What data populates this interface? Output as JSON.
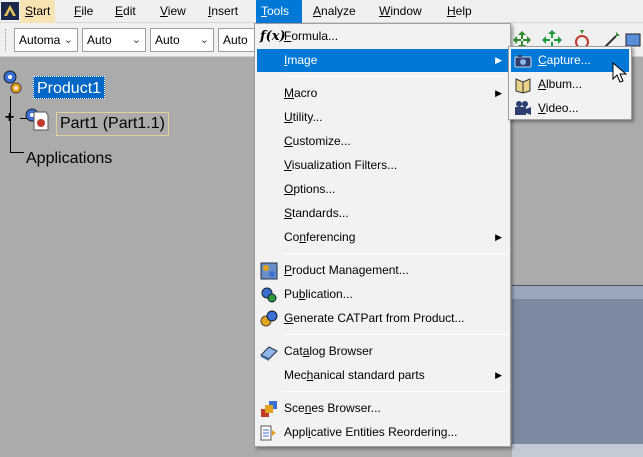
{
  "menubar": {
    "items": [
      {
        "label": "Start",
        "mnemonic": "S",
        "rest": "tart"
      },
      {
        "label": "File",
        "mnemonic": "F",
        "rest": "ile"
      },
      {
        "label": "Edit",
        "mnemonic": "E",
        "rest": "dit"
      },
      {
        "label": "View",
        "mnemonic": "V",
        "rest": "iew"
      },
      {
        "label": "Insert",
        "mnemonic": "I",
        "rest": "nsert"
      },
      {
        "label": "Tools",
        "mnemonic": "T",
        "rest": "ools"
      },
      {
        "label": "Analyze",
        "mnemonic": "A",
        "rest": "nalyze"
      },
      {
        "label": "Window",
        "mnemonic": "W",
        "rest": "indow"
      },
      {
        "label": "Help",
        "mnemonic": "H",
        "rest": "elp"
      }
    ]
  },
  "toolbar": {
    "combos": [
      "Automa",
      "Auto",
      "Auto",
      "Auto"
    ]
  },
  "tree": {
    "root": "Product1",
    "child": "Part1 (Part1.1)",
    "apps": "Applications"
  },
  "tools_menu": {
    "items": [
      {
        "pre": "",
        "u": "F",
        "post": "ormula...",
        "icon": "formula-icon"
      },
      {
        "pre": "",
        "u": "I",
        "post": "mage",
        "icon": "",
        "submenu": true
      },
      {
        "pre": "",
        "u": "M",
        "post": "acro",
        "icon": "",
        "submenu": true
      },
      {
        "pre": "",
        "u": "U",
        "post": "tility...",
        "icon": ""
      },
      {
        "pre": "",
        "u": "C",
        "post": "ustomize...",
        "icon": ""
      },
      {
        "pre": "",
        "u": "V",
        "post": "isualization Filters...",
        "icon": ""
      },
      {
        "pre": "",
        "u": "O",
        "post": "ptions...",
        "icon": ""
      },
      {
        "pre": "",
        "u": "S",
        "post": "tandards...",
        "icon": ""
      },
      {
        "pre": "Co",
        "u": "n",
        "post": "ferencing",
        "icon": "",
        "submenu": true
      },
      {
        "pre": "",
        "u": "P",
        "post": "roduct Management...",
        "icon": "product-management-icon"
      },
      {
        "pre": "Pu",
        "u": "b",
        "post": "lication...",
        "icon": "publication-icon"
      },
      {
        "pre": "",
        "u": "G",
        "post": "enerate CATPart from Product...",
        "icon": "generate-catpart-icon"
      },
      {
        "pre": "Cat",
        "u": "a",
        "post": "log Browser",
        "icon": "catalog-browser-icon"
      },
      {
        "pre": "Mec",
        "u": "h",
        "post": "anical standard parts",
        "icon": "",
        "submenu": true
      },
      {
        "pre": "Sce",
        "u": "n",
        "post": "es Browser...",
        "icon": "scenes-browser-icon"
      },
      {
        "pre": "Appl",
        "u": "i",
        "post": "cative Entities Reordering...",
        "icon": "applicative-entities-icon"
      }
    ],
    "submenu_arrow": "▶"
  },
  "image_menu": {
    "items": [
      {
        "pre": "",
        "u": "C",
        "post": "apture...",
        "icon": "camera-icon"
      },
      {
        "pre": "",
        "u": "A",
        "post": "lbum...",
        "icon": "album-icon"
      },
      {
        "pre": "",
        "u": "V",
        "post": "ideo...",
        "icon": "video-camera-icon"
      }
    ]
  }
}
